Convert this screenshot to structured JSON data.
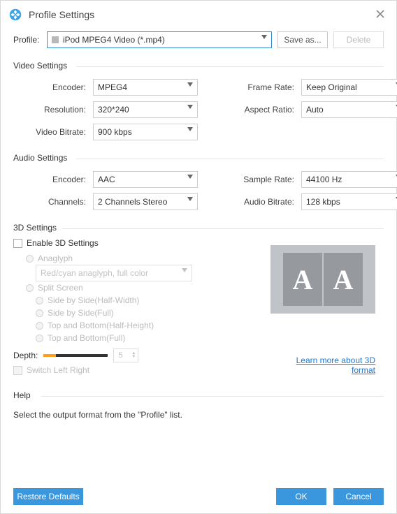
{
  "title": "Profile Settings",
  "profile": {
    "label": "Profile:",
    "value": "iPod MPEG4 Video (*.mp4)",
    "save_as": "Save as...",
    "delete": "Delete"
  },
  "video": {
    "heading": "Video Settings",
    "encoder_l": "Encoder:",
    "encoder_v": "MPEG4",
    "resolution_l": "Resolution:",
    "resolution_v": "320*240",
    "bitrate_l": "Video Bitrate:",
    "bitrate_v": "900 kbps",
    "framerate_l": "Frame Rate:",
    "framerate_v": "Keep Original",
    "aspect_l": "Aspect Ratio:",
    "aspect_v": "Auto"
  },
  "audio": {
    "heading": "Audio Settings",
    "encoder_l": "Encoder:",
    "encoder_v": "AAC",
    "channels_l": "Channels:",
    "channels_v": "2 Channels Stereo",
    "samplerate_l": "Sample Rate:",
    "samplerate_v": "44100 Hz",
    "abitrate_l": "Audio Bitrate:",
    "abitrate_v": "128 kbps"
  },
  "threed": {
    "heading": "3D Settings",
    "enable": "Enable 3D Settings",
    "anaglyph": "Anaglyph",
    "anaglyph_mode": "Red/cyan anaglyph, full color",
    "split": "Split Screen",
    "sbs_half": "Side by Side(Half-Width)",
    "sbs_full": "Side by Side(Full)",
    "tab_half": "Top and Bottom(Half-Height)",
    "tab_full": "Top and Bottom(Full)",
    "depth_l": "Depth:",
    "depth_v": "5",
    "switch_lr": "Switch Left Right",
    "learn": "Learn more about 3D format",
    "preview_a": "A",
    "preview_b": "A"
  },
  "help": {
    "heading": "Help",
    "body": "Select the output format from the \"Profile\" list."
  },
  "footer": {
    "restore": "Restore Defaults",
    "ok": "OK",
    "cancel": "Cancel"
  }
}
